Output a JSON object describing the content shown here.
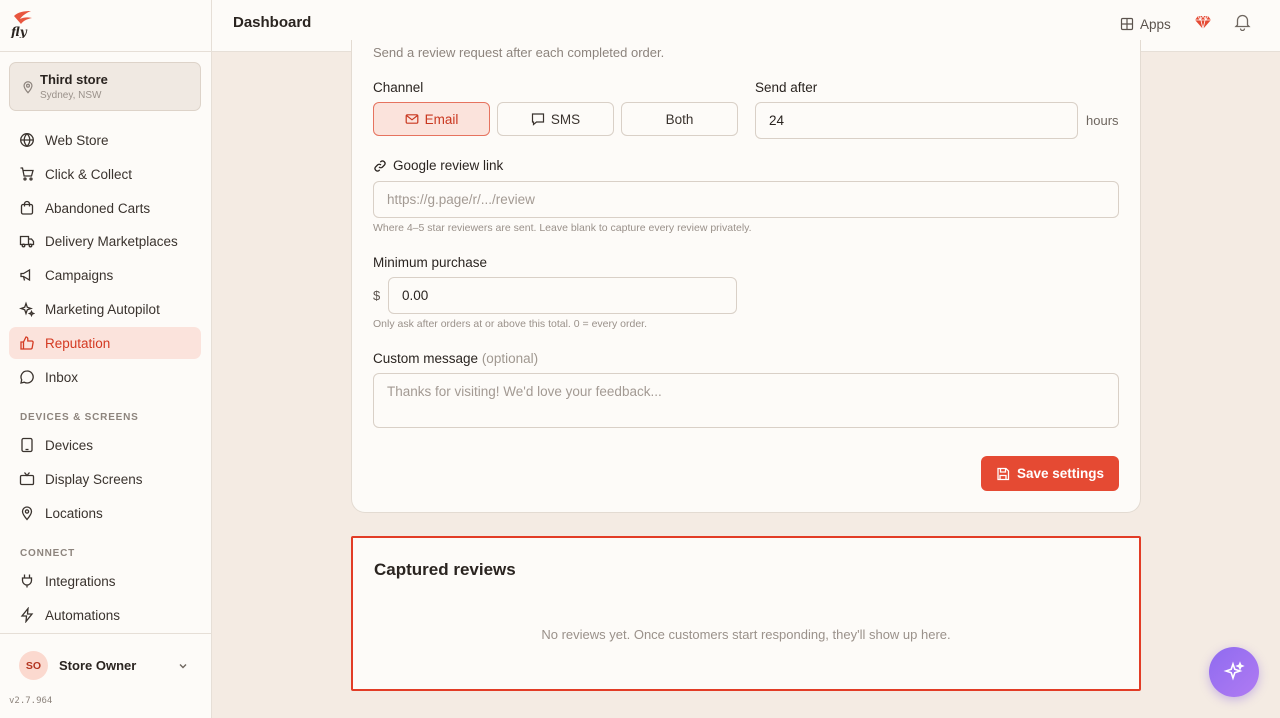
{
  "app": {
    "logo_text": "fly"
  },
  "store": {
    "name": "Third store",
    "location": "Sydney, NSW"
  },
  "sidebar": {
    "items": [
      {
        "label": "Web Store",
        "icon": "globe-icon"
      },
      {
        "label": "Click & Collect",
        "icon": "cart-icon"
      },
      {
        "label": "Abandoned Carts",
        "icon": "bag-icon"
      },
      {
        "label": "Delivery Marketplaces",
        "icon": "truck-icon"
      },
      {
        "label": "Campaigns",
        "icon": "megaphone-icon"
      },
      {
        "label": "Marketing Autopilot",
        "icon": "sparkles-icon"
      },
      {
        "label": "Reputation",
        "icon": "thumbs-up-icon",
        "active": true
      },
      {
        "label": "Inbox",
        "icon": "chat-icon"
      }
    ],
    "sections": [
      {
        "label": "DEVICES & SCREENS",
        "items": [
          {
            "label": "Devices",
            "icon": "device-icon"
          },
          {
            "label": "Display Screens",
            "icon": "tv-icon"
          },
          {
            "label": "Locations",
            "icon": "pin-icon"
          }
        ]
      },
      {
        "label": "CONNECT",
        "items": [
          {
            "label": "Integrations",
            "icon": "plug-icon"
          },
          {
            "label": "Automations",
            "icon": "bolt-icon"
          }
        ]
      }
    ],
    "user": {
      "initials": "SO",
      "name": "Store Owner"
    },
    "version": "v2.7.964"
  },
  "header": {
    "title": "Dashboard",
    "apps_label": "Apps"
  },
  "settings": {
    "intro": "Send a review request after each completed order.",
    "channel_label": "Channel",
    "channels": [
      "Email",
      "SMS",
      "Both"
    ],
    "selected_channel": "Email",
    "send_after_label": "Send after",
    "send_after_value": "24",
    "send_after_unit": "hours",
    "google_link_label": "Google review link",
    "google_link_placeholder": "https://g.page/r/.../review",
    "google_link_hint": "Where 4–5 star reviewers are sent. Leave blank to capture every review privately.",
    "min_purchase_label": "Minimum purchase",
    "currency_symbol": "$",
    "min_purchase_value": "0.00",
    "min_purchase_hint": "Only ask after orders at or above this total. 0 = every order.",
    "custom_message_label": "Custom message",
    "custom_message_optional": "(optional)",
    "custom_message_placeholder": "Thanks for visiting! We'd love your feedback...",
    "save_label": "Save settings"
  },
  "reviews": {
    "title": "Captured reviews",
    "empty_text": "No reviews yet. Once customers start responding, they'll show up here."
  },
  "colors": {
    "accent": "#e54a33",
    "active_bg": "#fbe3dc",
    "assistant": "#9a70f0"
  }
}
